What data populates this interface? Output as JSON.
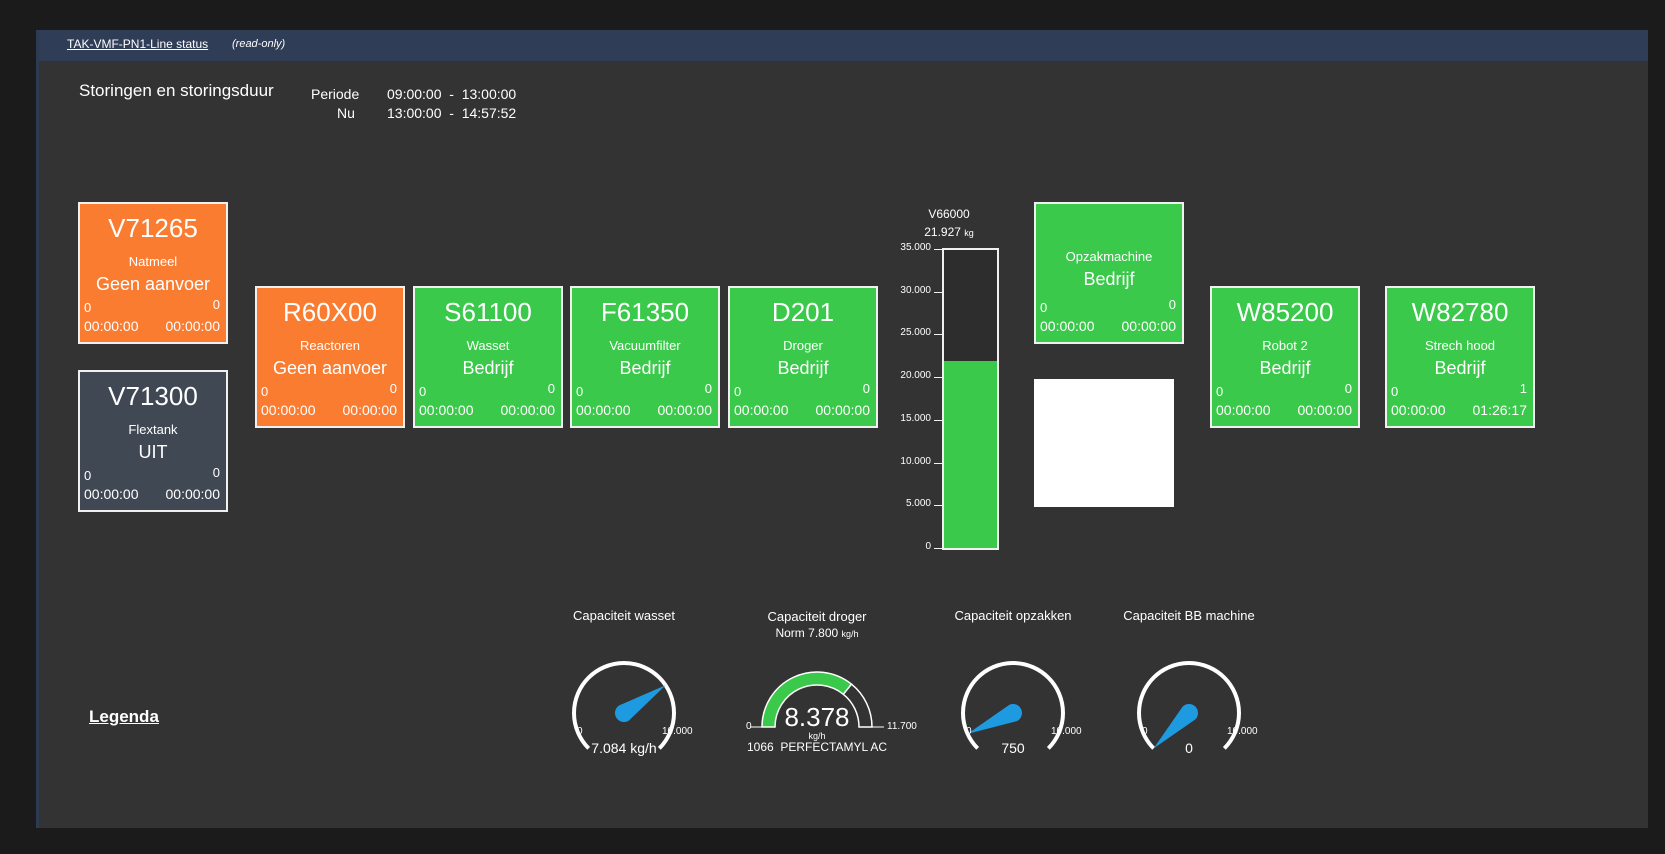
{
  "header": {
    "title": "TAK-VMF-PN1-Line status",
    "mode": "(read-only)"
  },
  "main_title": "Storingen en storingsduur",
  "periods": {
    "periode_label": "Periode",
    "periode_value": "09:00:00  -  13:00:00",
    "nu_label": "Nu",
    "nu_value": "13:00:00  -  14:57:52"
  },
  "tiles": [
    {
      "code": "V71265",
      "name": "Natmeel",
      "state": "Geen aanvoer",
      "count_left": "0",
      "count_right": "0",
      "time_left": "00:00:00",
      "time_right": "00:00:00",
      "color": "#fa7c31"
    },
    {
      "code": "V71300",
      "name": "Flextank",
      "state": "UIT",
      "count_left": "0",
      "count_right": "0",
      "time_left": "00:00:00",
      "time_right": "00:00:00",
      "color": "#404854"
    },
    {
      "code": "R60X00",
      "name": "Reactoren",
      "state": "Geen aanvoer",
      "count_left": "0",
      "count_right": "0",
      "time_left": "00:00:00",
      "time_right": "00:00:00",
      "color": "#fa7c31"
    },
    {
      "code": "S61100",
      "name": "Wasset",
      "state": "Bedrijf",
      "count_left": "0",
      "count_right": "0",
      "time_left": "00:00:00",
      "time_right": "00:00:00",
      "color": "#3ac94a"
    },
    {
      "code": "F61350",
      "name": "Vacuumfilter",
      "state": "Bedrijf",
      "count_left": "0",
      "count_right": "0",
      "time_left": "00:00:00",
      "time_right": "00:00:00",
      "color": "#3ac94a"
    },
    {
      "code": "D201",
      "name": "Droger",
      "state": "Bedrijf",
      "count_left": "0",
      "count_right": "0",
      "time_left": "00:00:00",
      "time_right": "00:00:00",
      "color": "#3ac94a"
    },
    {
      "code": "",
      "name": "Opzakmachine",
      "state": "Bedrijf",
      "count_left": "0",
      "count_right": "0",
      "time_left": "00:00:00",
      "time_right": "00:00:00",
      "color": "#3ac94a"
    },
    {
      "code": "W85200",
      "name": "Robot 2",
      "state": "Bedrijf",
      "count_left": "0",
      "count_right": "0",
      "time_left": "00:00:00",
      "time_right": "00:00:00",
      "color": "#3ac94a"
    },
    {
      "code": "W82780",
      "name": "Strech hood",
      "state": "Bedrijf",
      "count_left": "0",
      "count_right": "1",
      "time_left": "00:00:00",
      "time_right": "01:26:17",
      "color": "#3ac94a"
    }
  ],
  "silo": {
    "name": "V66000",
    "value": "21.927",
    "unit": "kg",
    "level": 21927,
    "max": 35000,
    "ticks": [
      "35.000",
      "30.000",
      "25.000",
      "20.000",
      "15.000",
      "10.000",
      "5.000",
      "0"
    ],
    "fill_color": "#3ac94a"
  },
  "gauges": [
    {
      "title": "Capaciteit wasset",
      "min": "0",
      "max": "10.000",
      "value": 7084,
      "max_value": 10000,
      "readout": "7.084 kg/h"
    },
    {
      "title": "Capaciteit opzakken",
      "min": "0",
      "max": "10.000",
      "value": 750,
      "max_value": 10000,
      "readout": "750"
    },
    {
      "title": "Capaciteit BB machine",
      "min": "0",
      "max": "10.000",
      "value": 0,
      "max_value": 10000,
      "readout": "0"
    }
  ],
  "droger_gauge": {
    "title": "Capaciteit droger",
    "norm_label": "Norm",
    "norm_value": "7.800",
    "norm_unit": "kg/h",
    "min": "0",
    "max": "11.700",
    "value": 8378,
    "max_value": 11700,
    "norm": 7800,
    "big_value": "8.378",
    "unit": "kg/h",
    "product": "1066  PERFECTAMYL AC"
  },
  "legenda": "Legenda",
  "colors": {
    "green": "#3ac94a",
    "orange": "#fa7c31",
    "grey": "#404854",
    "needle": "#1e9be0"
  }
}
